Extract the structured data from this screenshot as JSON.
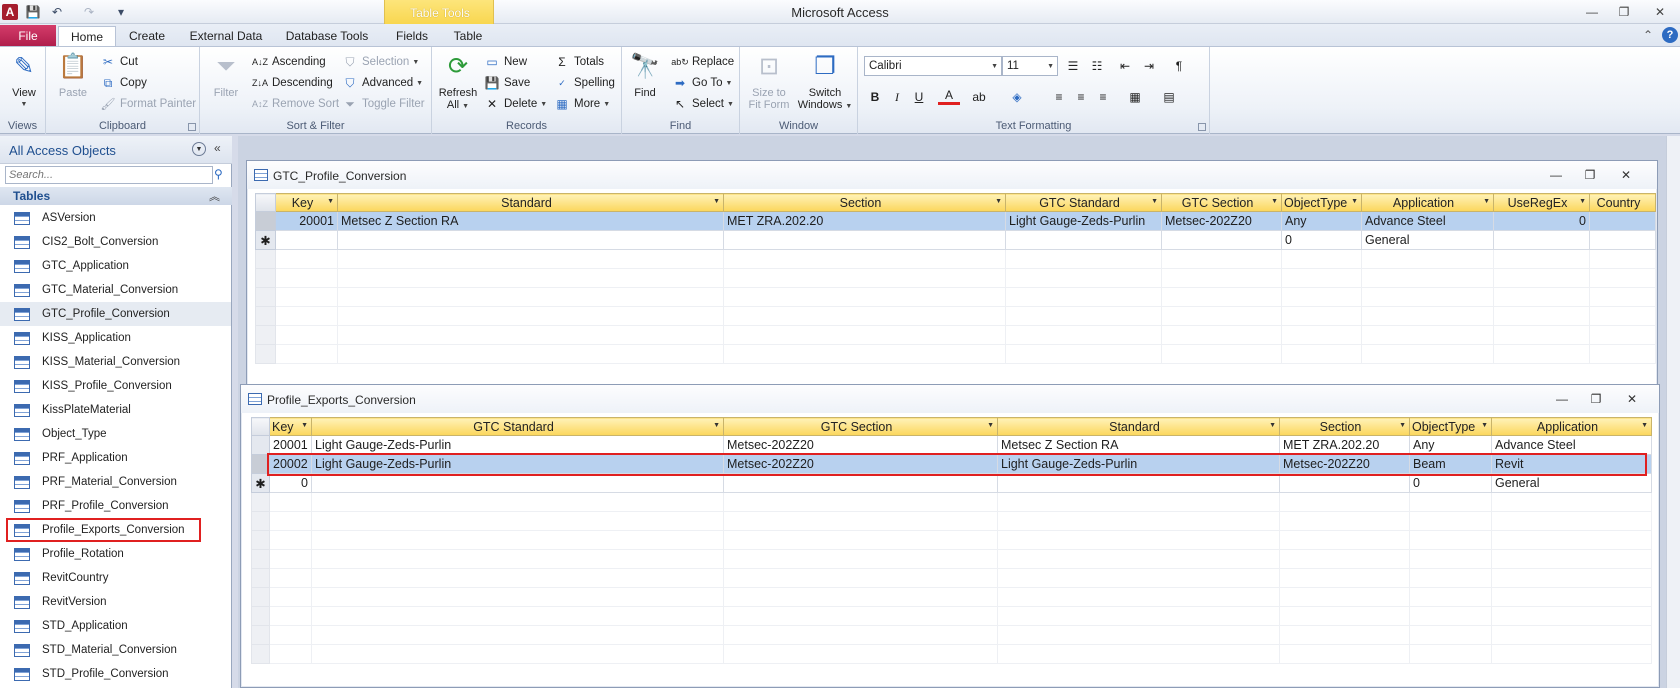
{
  "app": {
    "title": "Microsoft Access",
    "logo": "A",
    "contextual_tab_group": "Table Tools"
  },
  "qat": {
    "save_icon": "💾",
    "undo_icon": "↶",
    "redo_icon": "↷",
    "customize_icon": "▾"
  },
  "tabs": [
    "File",
    "Home",
    "Create",
    "External Data",
    "Database Tools",
    "Fields",
    "Table"
  ],
  "ribbon": {
    "views": {
      "view": "View",
      "label": "Views"
    },
    "clipboard": {
      "paste": "Paste",
      "cut": "Cut",
      "copy": "Copy",
      "format_painter": "Format Painter",
      "label": "Clipboard"
    },
    "sort_filter": {
      "filter": "Filter",
      "ascending": "Ascending",
      "descending": "Descending",
      "remove_sort": "Remove Sort",
      "selection": "Selection",
      "advanced": "Advanced",
      "toggle_filter": "Toggle Filter",
      "label": "Sort & Filter"
    },
    "records": {
      "refresh": "Refresh",
      "refresh_all": "All",
      "new": "New",
      "save": "Save",
      "delete": "Delete",
      "totals": "Totals",
      "spelling": "Spelling",
      "more": "More",
      "label": "Records"
    },
    "find": {
      "find": "Find",
      "replace": "Replace",
      "goto": "Go To",
      "select": "Select",
      "label": "Find"
    },
    "window": {
      "size_to_fit_1": "Size to",
      "size_to_fit_2": "Fit Form",
      "switch_1": "Switch",
      "switch_2": "Windows",
      "label": "Window"
    },
    "text_formatting": {
      "font": "Calibri",
      "size": "11",
      "label": "Text Formatting"
    }
  },
  "nav": {
    "title": "All Access Objects",
    "search_placeholder": "Search...",
    "section": "Tables",
    "items": [
      "ASVersion",
      "CIS2_Bolt_Conversion",
      "GTC_Application",
      "GTC_Material_Conversion",
      "GTC_Profile_Conversion",
      "KISS_Application",
      "KISS_Material_Conversion",
      "KISS_Profile_Conversion",
      "KissPlateMaterial",
      "Object_Type",
      "PRF_Application",
      "PRF_Material_Conversion",
      "PRF_Profile_Conversion",
      "Profile_Exports_Conversion",
      "Profile_Rotation",
      "RevitCountry",
      "RevitVersion",
      "STD_Application",
      "STD_Material_Conversion",
      "STD_Profile_Conversion"
    ]
  },
  "window1": {
    "title": "GTC_Profile_Conversion",
    "columns": [
      "Key",
      "Standard",
      "Section",
      "GTC Standard",
      "GTC Section",
      "ObjectType",
      "Application",
      "UseRegEx",
      "Country"
    ],
    "rows": [
      [
        "20001",
        "Metsec Z Section RA",
        "MET ZRA.202.20",
        "Light Gauge-Zeds-Purlin",
        "Metsec-202Z20",
        "Any",
        "Advance Steel",
        "0",
        ""
      ]
    ],
    "new_row": [
      "",
      "",
      "",
      "",
      "",
      "0",
      "General",
      "",
      ""
    ],
    "new_marker": "✱"
  },
  "window2": {
    "title": "Profile_Exports_Conversion",
    "columns": [
      "Key",
      "GTC Standard",
      "GTC Section",
      "Standard",
      "Section",
      "ObjectType",
      "Application"
    ],
    "rows": [
      [
        "20001",
        "Light Gauge-Zeds-Purlin",
        "Metsec-202Z20",
        "Metsec Z Section RA",
        "MET ZRA.202.20",
        "Any",
        "Advance Steel"
      ],
      [
        "20002",
        "Light Gauge-Zeds-Purlin",
        "Metsec-202Z20",
        "Light Gauge-Zeds-Purlin",
        "Metsec-202Z20",
        "Beam",
        "Revit"
      ]
    ],
    "new_row": [
      "0",
      "",
      "",
      "",
      "",
      "0",
      "General"
    ],
    "new_marker": "✱"
  },
  "colors": {
    "highlight": "#e02020",
    "selected_row": "#b8d1ef",
    "header": "#fbd65b",
    "file_tab": "#b01e4c"
  }
}
